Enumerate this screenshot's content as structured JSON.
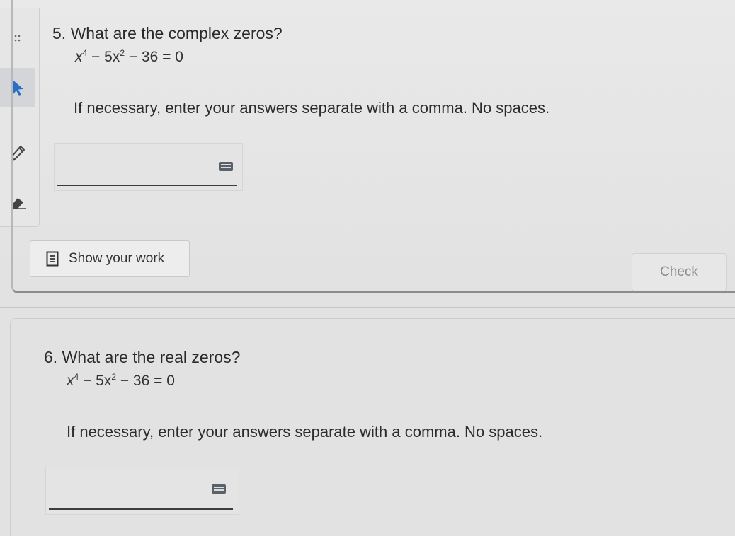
{
  "tools": {
    "drag": "drag-handle-icon",
    "pointer": "pointer-arrow-icon",
    "pencil": "pencil-icon",
    "eraser": "eraser-icon",
    "accent_color": "#2a6ec7"
  },
  "q5": {
    "number": "5.",
    "title": "What are the complex zeros?",
    "equation": {
      "x": "x",
      "exp1": "4",
      "mid": " − 5x",
      "exp2": "2",
      "rest": " − 36 = 0"
    },
    "instructions": "If necessary, enter your answers separate with a comma. No spaces.",
    "answer_value": "",
    "keyboard_icon": "keyboard-icon"
  },
  "actions": {
    "show_work_label": "Show your work",
    "show_work_icon": "notes-icon",
    "check_label": "Check"
  },
  "q6": {
    "number": "6.",
    "title": "What are the real zeros?",
    "equation": {
      "x": "x",
      "exp1": "4",
      "mid": " − 5x",
      "exp2": "2",
      "rest": " − 36 = 0"
    },
    "instructions": "If necessary, enter your answers separate with a comma. No spaces.",
    "answer_value": "",
    "keyboard_icon": "keyboard-icon"
  }
}
